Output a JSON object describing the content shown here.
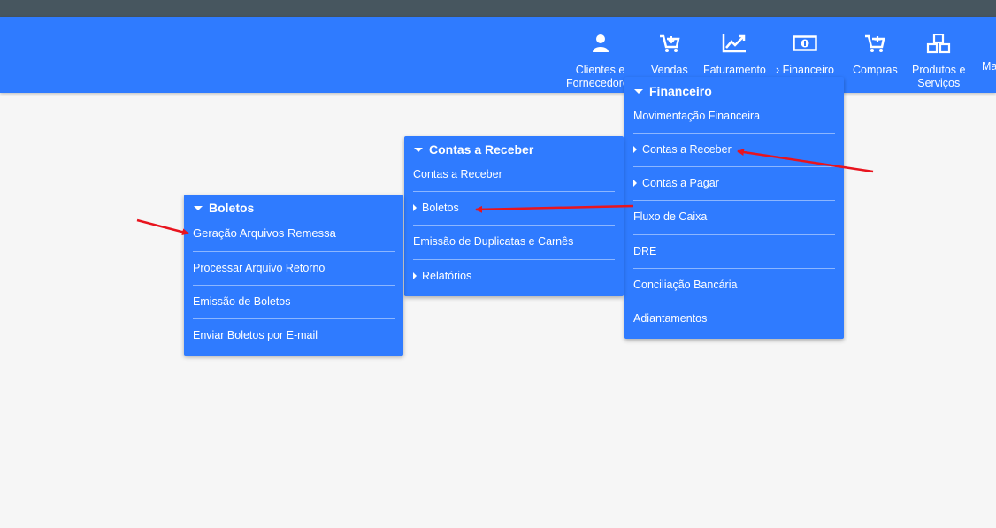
{
  "nav": {
    "items": [
      {
        "line1": "Clientes e",
        "line2": "Fornecedores",
        "icon": "user-icon"
      },
      {
        "line1": "Vendas",
        "line2": "",
        "icon": "cart-download-icon"
      },
      {
        "line1": "Faturamento",
        "line2": "",
        "icon": "chart-line-icon"
      },
      {
        "line1": "› Financeiro",
        "line2": "",
        "icon": "money-bill-icon"
      },
      {
        "line1": "Compras",
        "line2": "",
        "icon": "cart-plus-icon"
      },
      {
        "line1": "Produtos e",
        "line2": "Serviços",
        "icon": "cubes-icon"
      },
      {
        "line1": "Ma",
        "line2": "",
        "icon": ""
      }
    ]
  },
  "financeiro_menu": {
    "title": "Financeiro",
    "items": [
      "Movimentação Financeira",
      "Contas a Receber",
      "Contas a Pagar",
      "Fluxo de Caixa",
      "DRE",
      "Conciliação Bancária",
      "Adiantamentos"
    ]
  },
  "contas_receber_menu": {
    "title": "Contas a Receber",
    "items": [
      "Contas a Receber",
      "Boletos",
      "Emissão de Duplicatas e Carnês",
      "Relatórios"
    ]
  },
  "boletos_menu": {
    "title": "Boletos",
    "items": [
      "Geração Arquivos Remessa",
      "Processar Arquivo Retorno",
      "Emissão de Boletos",
      "Enviar Boletos por E-mail"
    ]
  },
  "colors": {
    "navbar": "#2f7bff",
    "topstrip": "#47565f",
    "annotation_arrow": "#e8141e"
  }
}
